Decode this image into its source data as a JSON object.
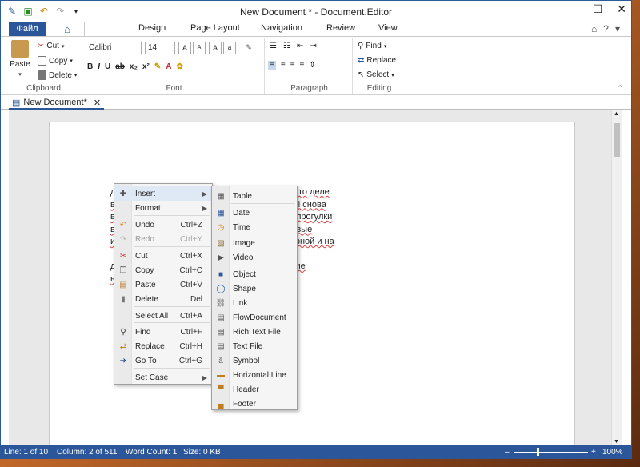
{
  "window": {
    "title": "New Document * - Document.Editor"
  },
  "tabs": {
    "file": "Файл",
    "home_icon": "home-icon",
    "items": [
      "Design",
      "Page Layout",
      "Navigation",
      "Review",
      "View"
    ]
  },
  "clipboard": {
    "paste": "Paste",
    "cut": "Cut",
    "copy": "Copy",
    "delete": "Delete",
    "label": "Clipboard"
  },
  "font": {
    "family": "Calibri",
    "size": "14",
    "label": "Font"
  },
  "paragraph": {
    "label": "Paragraph"
  },
  "editing": {
    "find": "Find",
    "replace": "Replace",
    "select": "Select",
    "label": "Editing"
  },
  "doc_tab": {
    "name": "New Document*"
  },
  "document": {
    "lines": [
      "д. А ведь кажется только вчера (ну, на самом-то деле",
      "вышли на работу после длинных выходных. И снова",
      "вольствий. Сон до обеда, лень и неспешные прогулки",
      "в лес, к морю, наплевав на клещей и штормовые",
      "ирует шашлык, и мы ему завидуем белой, черной и на",
      "",
      "да много работы. Посмотрите, например, какие",
      "ведь."
    ]
  },
  "context_menu": [
    {
      "label": "Insert",
      "shortcut": "",
      "icon": "insert-icon",
      "submenu": true,
      "disabled": false
    },
    {
      "label": "Format",
      "shortcut": "",
      "icon": "",
      "submenu": true,
      "disabled": false
    },
    {
      "label": "Undo",
      "shortcut": "Ctrl+Z",
      "icon": "undo-icon",
      "submenu": false,
      "disabled": false
    },
    {
      "label": "Redo",
      "shortcut": "Ctrl+Y",
      "icon": "redo-icon",
      "submenu": false,
      "disabled": true
    },
    {
      "label": "Cut",
      "shortcut": "Ctrl+X",
      "icon": "scissors-icon",
      "submenu": false,
      "disabled": false
    },
    {
      "label": "Copy",
      "shortcut": "Ctrl+C",
      "icon": "copy-icon",
      "submenu": false,
      "disabled": false
    },
    {
      "label": "Paste",
      "shortcut": "Ctrl+V",
      "icon": "paste-icon",
      "submenu": false,
      "disabled": false
    },
    {
      "label": "Delete",
      "shortcut": "Del",
      "icon": "trash-icon",
      "submenu": false,
      "disabled": false
    },
    {
      "label": "Select All",
      "shortcut": "Ctrl+A",
      "icon": "",
      "submenu": false,
      "disabled": false
    },
    {
      "label": "Find",
      "shortcut": "Ctrl+F",
      "icon": "binoculars-icon",
      "submenu": false,
      "disabled": false
    },
    {
      "label": "Replace",
      "shortcut": "Ctrl+H",
      "icon": "replace-icon",
      "submenu": false,
      "disabled": false
    },
    {
      "label": "Go To",
      "shortcut": "Ctrl+G",
      "icon": "goto-icon",
      "submenu": false,
      "disabled": false
    },
    {
      "label": "Set Case",
      "shortcut": "",
      "icon": "",
      "submenu": true,
      "disabled": false
    }
  ],
  "insert_submenu": [
    "Table",
    "Date",
    "Time",
    "Image",
    "Video",
    "Object",
    "Shape",
    "Link",
    "FlowDocument",
    "Rich Text File",
    "Text File",
    "Symbol",
    "Horizontal Line",
    "Header",
    "Footer"
  ],
  "status": {
    "line": "Line: 1 of 10",
    "column": "Column: 2 of 511",
    "words": "Word Count: 1",
    "size": "Size: 0 KB",
    "zoom": "100%"
  },
  "colors": {
    "accent": "#2b579a",
    "highlight": "#dfe9f5",
    "spell_underline": "#e04040"
  }
}
